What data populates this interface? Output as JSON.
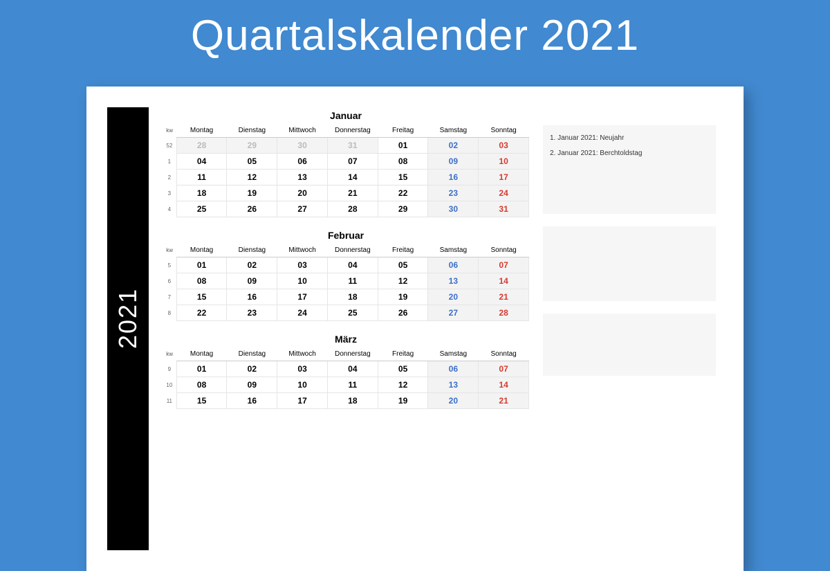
{
  "title": "Quartalskalender 2021",
  "year": "2021",
  "kw_label": "kw",
  "weekdays": [
    "Montag",
    "Dienstag",
    "Mittwoch",
    "Donnerstag",
    "Freitag",
    "Samstag",
    "Sonntag"
  ],
  "months": [
    {
      "name": "Januar",
      "weeks": [
        {
          "kw": "52",
          "days": [
            {
              "d": "28",
              "t": "prev"
            },
            {
              "d": "29",
              "t": "prev"
            },
            {
              "d": "30",
              "t": "prev"
            },
            {
              "d": "31",
              "t": "prev"
            },
            {
              "d": "01",
              "t": ""
            },
            {
              "d": "02",
              "t": "sat"
            },
            {
              "d": "03",
              "t": "sun"
            }
          ]
        },
        {
          "kw": "1",
          "days": [
            {
              "d": "04",
              "t": ""
            },
            {
              "d": "05",
              "t": ""
            },
            {
              "d": "06",
              "t": ""
            },
            {
              "d": "07",
              "t": ""
            },
            {
              "d": "08",
              "t": ""
            },
            {
              "d": "09",
              "t": "sat"
            },
            {
              "d": "10",
              "t": "sun"
            }
          ]
        },
        {
          "kw": "2",
          "days": [
            {
              "d": "11",
              "t": ""
            },
            {
              "d": "12",
              "t": ""
            },
            {
              "d": "13",
              "t": ""
            },
            {
              "d": "14",
              "t": ""
            },
            {
              "d": "15",
              "t": ""
            },
            {
              "d": "16",
              "t": "sat"
            },
            {
              "d": "17",
              "t": "sun"
            }
          ]
        },
        {
          "kw": "3",
          "days": [
            {
              "d": "18",
              "t": ""
            },
            {
              "d": "19",
              "t": ""
            },
            {
              "d": "20",
              "t": ""
            },
            {
              "d": "21",
              "t": ""
            },
            {
              "d": "22",
              "t": ""
            },
            {
              "d": "23",
              "t": "sat"
            },
            {
              "d": "24",
              "t": "sun"
            }
          ]
        },
        {
          "kw": "4",
          "days": [
            {
              "d": "25",
              "t": ""
            },
            {
              "d": "26",
              "t": ""
            },
            {
              "d": "27",
              "t": ""
            },
            {
              "d": "28",
              "t": ""
            },
            {
              "d": "29",
              "t": ""
            },
            {
              "d": "30",
              "t": "sat"
            },
            {
              "d": "31",
              "t": "sun"
            }
          ]
        }
      ],
      "notes": [
        "1. Januar 2021: Neujahr",
        "2. Januar 2021: Berchtoldstag"
      ]
    },
    {
      "name": "Februar",
      "weeks": [
        {
          "kw": "5",
          "days": [
            {
              "d": "01",
              "t": ""
            },
            {
              "d": "02",
              "t": ""
            },
            {
              "d": "03",
              "t": ""
            },
            {
              "d": "04",
              "t": ""
            },
            {
              "d": "05",
              "t": ""
            },
            {
              "d": "06",
              "t": "sat"
            },
            {
              "d": "07",
              "t": "sun"
            }
          ]
        },
        {
          "kw": "6",
          "days": [
            {
              "d": "08",
              "t": ""
            },
            {
              "d": "09",
              "t": ""
            },
            {
              "d": "10",
              "t": ""
            },
            {
              "d": "11",
              "t": ""
            },
            {
              "d": "12",
              "t": ""
            },
            {
              "d": "13",
              "t": "sat"
            },
            {
              "d": "14",
              "t": "sun"
            }
          ]
        },
        {
          "kw": "7",
          "days": [
            {
              "d": "15",
              "t": ""
            },
            {
              "d": "16",
              "t": ""
            },
            {
              "d": "17",
              "t": ""
            },
            {
              "d": "18",
              "t": ""
            },
            {
              "d": "19",
              "t": ""
            },
            {
              "d": "20",
              "t": "sat"
            },
            {
              "d": "21",
              "t": "sun"
            }
          ]
        },
        {
          "kw": "8",
          "days": [
            {
              "d": "22",
              "t": ""
            },
            {
              "d": "23",
              "t": ""
            },
            {
              "d": "24",
              "t": ""
            },
            {
              "d": "25",
              "t": ""
            },
            {
              "d": "26",
              "t": ""
            },
            {
              "d": "27",
              "t": "sat"
            },
            {
              "d": "28",
              "t": "sun"
            }
          ]
        }
      ],
      "notes": []
    },
    {
      "name": "März",
      "weeks": [
        {
          "kw": "9",
          "days": [
            {
              "d": "01",
              "t": ""
            },
            {
              "d": "02",
              "t": ""
            },
            {
              "d": "03",
              "t": ""
            },
            {
              "d": "04",
              "t": ""
            },
            {
              "d": "05",
              "t": ""
            },
            {
              "d": "06",
              "t": "sat"
            },
            {
              "d": "07",
              "t": "sun"
            }
          ]
        },
        {
          "kw": "10",
          "days": [
            {
              "d": "08",
              "t": ""
            },
            {
              "d": "09",
              "t": ""
            },
            {
              "d": "10",
              "t": ""
            },
            {
              "d": "11",
              "t": ""
            },
            {
              "d": "12",
              "t": ""
            },
            {
              "d": "13",
              "t": "sat"
            },
            {
              "d": "14",
              "t": "sun"
            }
          ]
        },
        {
          "kw": "11",
          "days": [
            {
              "d": "15",
              "t": ""
            },
            {
              "d": "16",
              "t": ""
            },
            {
              "d": "17",
              "t": ""
            },
            {
              "d": "18",
              "t": ""
            },
            {
              "d": "19",
              "t": ""
            },
            {
              "d": "20",
              "t": "sat"
            },
            {
              "d": "21",
              "t": "sun"
            }
          ]
        }
      ],
      "notes": []
    }
  ]
}
